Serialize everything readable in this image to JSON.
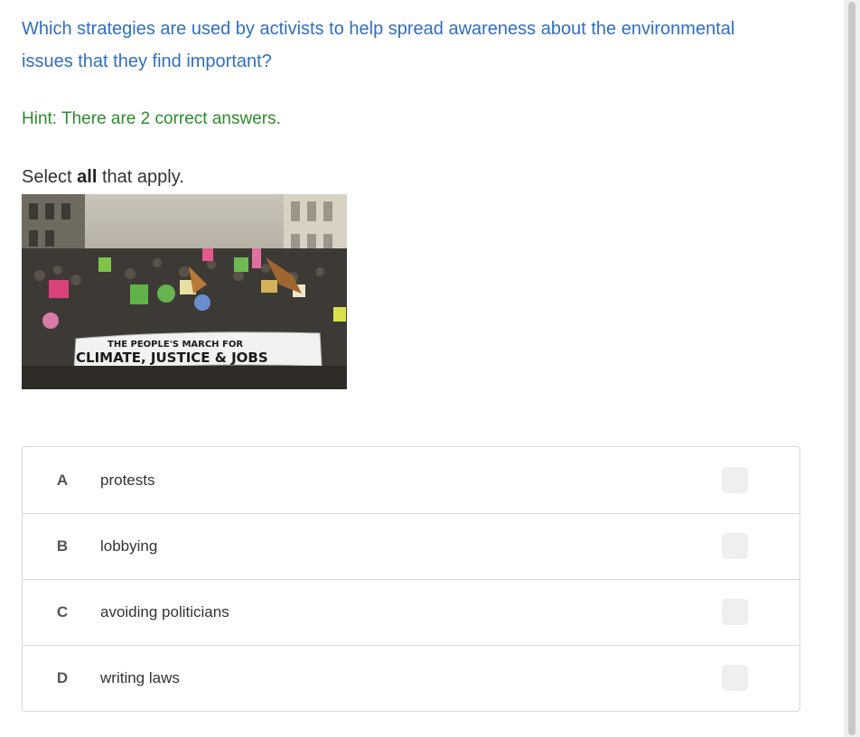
{
  "question": {
    "line1": "Which strategies are used by activists to help spread awareness about the environmental",
    "line2": "issues that they find important?"
  },
  "hint": "Hint: There are 2 correct answers.",
  "instruction": {
    "prefix": "Select ",
    "bold": "all",
    "suffix": " that apply."
  },
  "photo": {
    "banner_top": "THE PEOPLE'S MARCH FOR",
    "banner_bottom": "CLIMATE, JUSTICE & JOBS"
  },
  "choices": [
    {
      "letter": "A",
      "text": "protests"
    },
    {
      "letter": "B",
      "text": "lobbying"
    },
    {
      "letter": "C",
      "text": "avoiding politicians"
    },
    {
      "letter": "D",
      "text": "writing laws"
    }
  ],
  "colors": {
    "question": "#2f6fbf",
    "hint": "#2e8b2e"
  }
}
